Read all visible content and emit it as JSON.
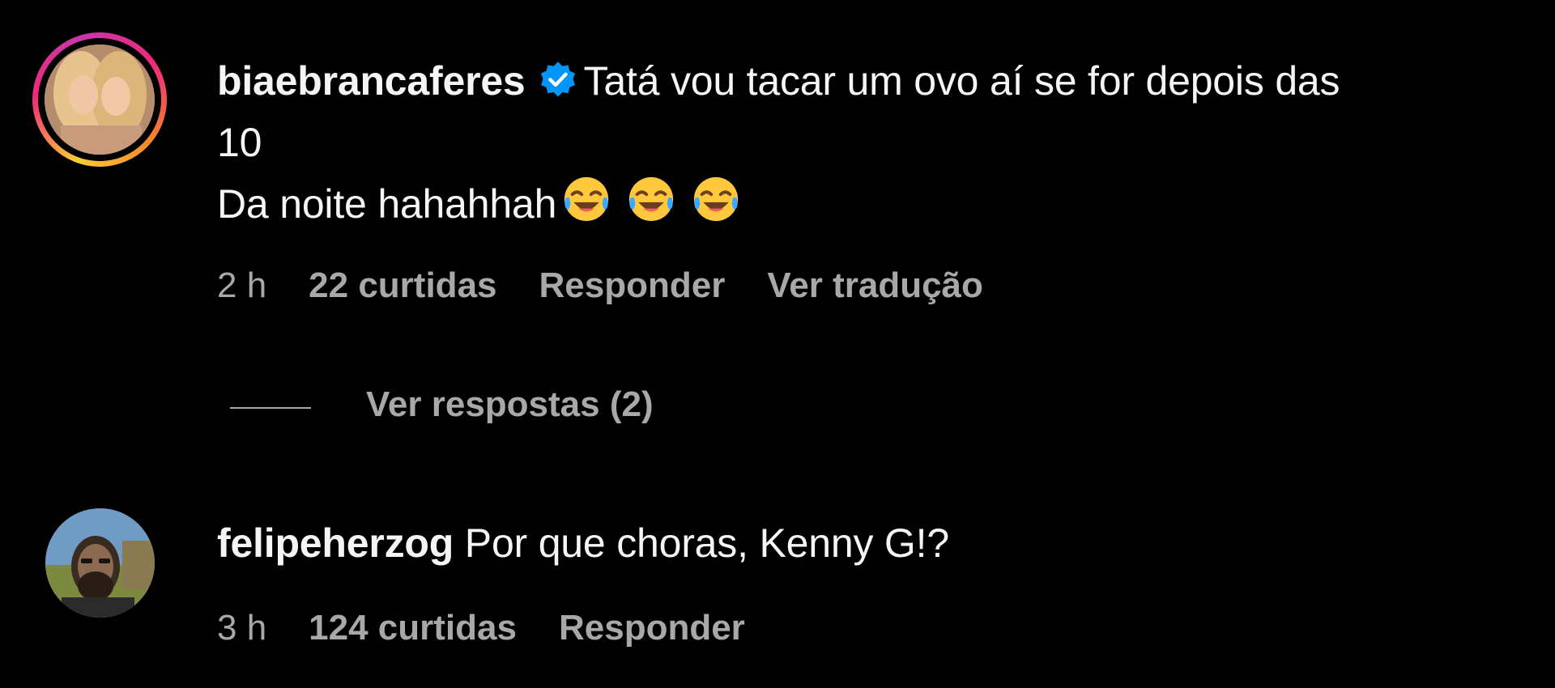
{
  "comments": [
    {
      "username": "biaebrancaferes",
      "verified": true,
      "text_line1": "Tatá vou tacar um ovo aí se for depois das",
      "text_line2": "10",
      "text_line3": "Da noite hahahhah",
      "emojis": [
        "face-with-tears-of-joy-icon",
        "face-with-tears-of-joy-icon",
        "face-with-tears-of-joy-icon"
      ],
      "time": "2 h",
      "likes": "22 curtidas",
      "reply": "Responder",
      "translate": "Ver tradução",
      "view_replies": "Ver respostas (2)"
    },
    {
      "username": "felipeherzog",
      "verified": false,
      "text": "Por que choras, Kenny G!?",
      "time": "3 h",
      "likes": "124 curtidas",
      "reply": "Responder"
    }
  ],
  "colors": {
    "background": "#000000",
    "text": "#f5f5f5",
    "muted": "#a8a8a8",
    "verified_blue": "#0095f6"
  }
}
